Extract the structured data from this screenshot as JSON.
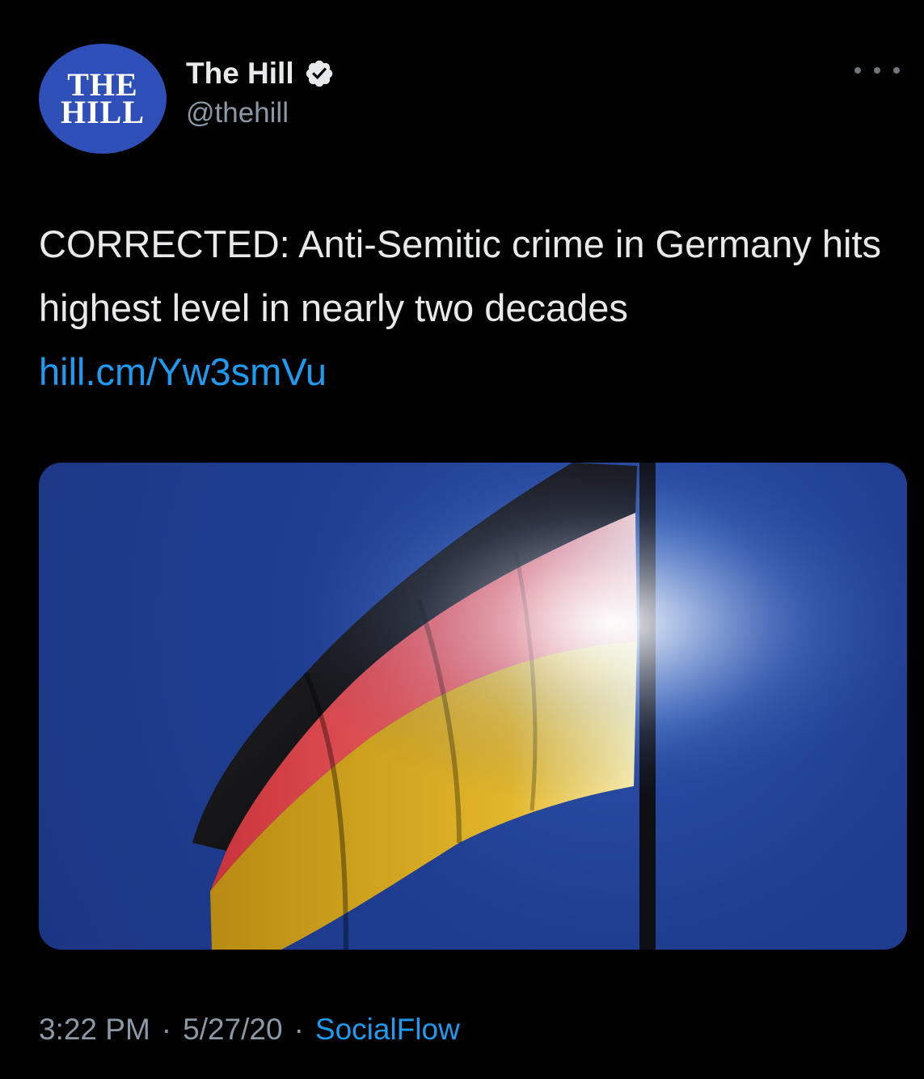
{
  "account": {
    "avatar_line1": "THE",
    "avatar_line2": "HILL",
    "display_name": "The Hill",
    "handle": "@thehill",
    "verified": true
  },
  "tweet": {
    "text": "CORRECTED: Anti-Semitic crime in Germany hits highest level in nearly two decades",
    "link": "hill.cm/Yw3smVu",
    "media_alt": "German flag waving against blue sky"
  },
  "meta": {
    "time": "3:22 PM",
    "date": "5/27/20",
    "separator": "·",
    "source": "SocialFlow"
  },
  "colors": {
    "background": "#000000",
    "text": "#e7e9ea",
    "secondary": "#8b98a5",
    "link": "#1d9bf0",
    "avatar": "#2f4fb8"
  },
  "icons": {
    "verified": "verified-badge-icon",
    "more": "more-options-icon"
  }
}
